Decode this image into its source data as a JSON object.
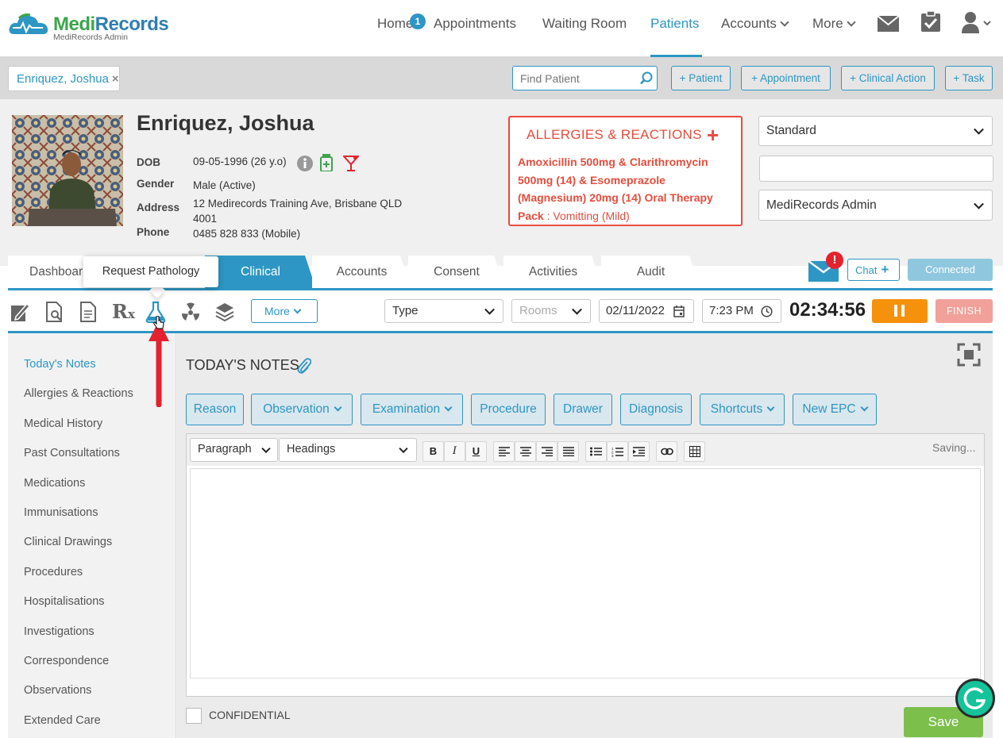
{
  "app": {
    "name_part1": "Medi",
    "name_part2": "Records",
    "subtitle": "MediRecords Admin"
  },
  "nav": {
    "home": "Home",
    "home_badge": "1",
    "appointments": "Appointments",
    "waiting_room": "Waiting Room",
    "patients": "Patients",
    "accounts": "Accounts",
    "more": "More"
  },
  "patient_tab": {
    "label": "Enriquez, Joshua",
    "close": "×"
  },
  "search": {
    "placeholder": "Find Patient"
  },
  "quick_actions": [
    "+ Patient",
    "+ Appointment",
    "+ Clinical Action",
    "+ Task"
  ],
  "patient": {
    "name": "Enriquez, Joshua",
    "dob_label": "DOB",
    "dob": "09-05-1996 (26 y.o)",
    "gender_label": "Gender",
    "gender": "Male (Active)",
    "address_label": "Address",
    "address": "12 Medirecords Training Ave, Brisbane QLD 4001",
    "phone_label": "Phone",
    "phone": "0485 828 833 (Mobile)"
  },
  "allergies": {
    "title": "ALLERGIES & REACTIONS",
    "add": "+",
    "item": "Amoxicillin 500mg & Clarithromycin 500mg (14) & Esomeprazole (Magnesium) 20mg (14) Oral Therapy Pack",
    "separator": " : ",
    "reaction": "Vomitting (Mild)"
  },
  "right_selects": {
    "fee_type": "Standard",
    "blank": "",
    "practitioner": "MediRecords Admin"
  },
  "tabs": [
    "Dashboard",
    "Clinical",
    "Accounts",
    "Consent",
    "Activities",
    "Audit"
  ],
  "active_tab": "Clinical",
  "tooltip": "Request Pathology",
  "chat": {
    "label": "Chat",
    "alert": "!",
    "connected": "Connected"
  },
  "toolbar": {
    "more": "More",
    "type_placeholder": "Type",
    "rooms_placeholder": "Rooms",
    "date": "02/11/2022",
    "time": "7:23 PM",
    "timer": "02:34:56",
    "finish": "FINISH"
  },
  "sidebar": [
    "Today's Notes",
    "Allergies & Reactions",
    "Medical History",
    "Past Consultations",
    "Medications",
    "Immunisations",
    "Clinical Drawings",
    "Procedures",
    "Hospitalisations",
    "Investigations",
    "Correspondence",
    "Observations",
    "Extended Care"
  ],
  "notes": {
    "title": "TODAY'S NOTES",
    "buttons": [
      "Reason",
      "Observation",
      "Examination",
      "Procedure",
      "Drawer",
      "Diagnosis",
      "Shortcuts",
      "New EPC"
    ],
    "paragraph": "Paragraph",
    "headings": "Headings",
    "saving": "Saving...",
    "bold": "B",
    "italic": "I",
    "underline": "U",
    "confidential": "CONFIDENTIAL",
    "save": "Save"
  },
  "colors": {
    "brand_blue": "#2d96c4",
    "brand_green": "#3aa64a",
    "alert_red": "#e74c3c",
    "pause_orange": "#f5910b",
    "save_green": "#7cc04b"
  }
}
